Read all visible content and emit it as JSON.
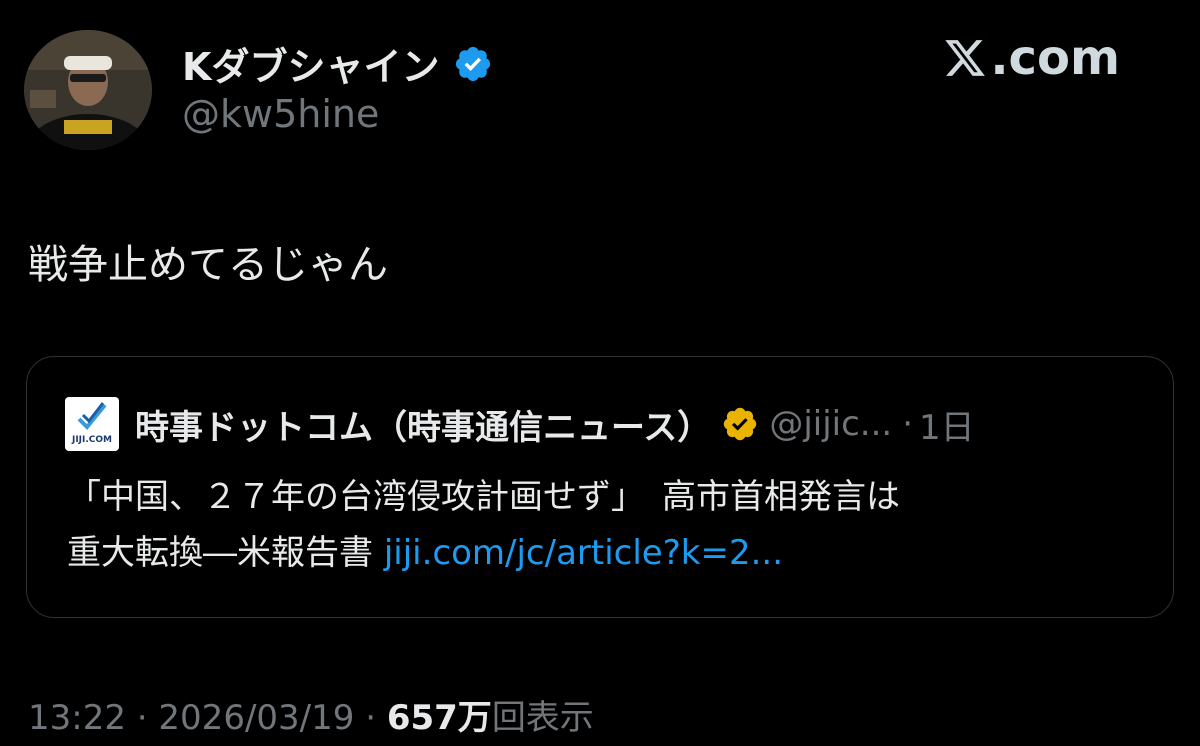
{
  "brand": {
    "label": ".com"
  },
  "author": {
    "display_name": "Kダブシャイン",
    "handle": "@kw5hine",
    "verified_color": "#1d9bf0"
  },
  "tweet": {
    "text": "戦争止めてるじゃん"
  },
  "quote": {
    "logo_text": "JIJI.COM",
    "name": "時事ドットコム（時事通信ニュース）",
    "handle": "@jijic...",
    "separator": "·",
    "time": "1日",
    "badge_color": "#e8b400",
    "line1": "「中国、２７年の台湾侵攻計画せず」　高市首相発言は",
    "line2_text": "重大転換―米報告書 ",
    "link": "jiji.com/jc/article?k=2..."
  },
  "meta": {
    "time": "13:22",
    "sep1": "·",
    "date": "2026/03/19",
    "sep2": "·",
    "views_count": "657万",
    "views_label": "回表示"
  },
  "colors": {
    "background": "#000000",
    "text": "#e7e9ea",
    "secondary": "#71767b",
    "link": "#1d9bf0",
    "border": "#2f3336"
  }
}
